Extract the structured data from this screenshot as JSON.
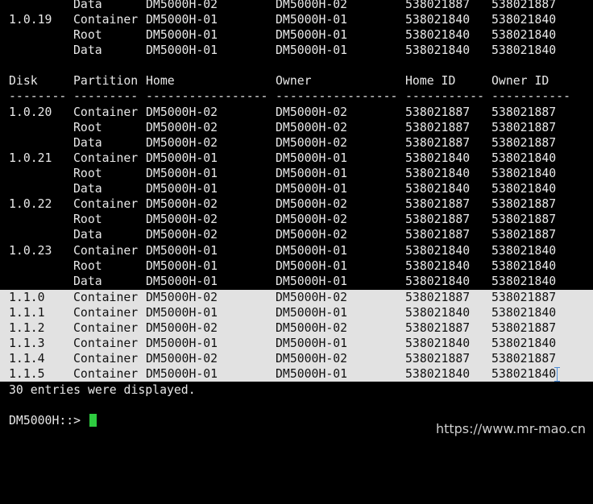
{
  "colors": {
    "background": "#000000",
    "text": "#e8e8e8",
    "selection": "#e2e2e2",
    "prompt_cursor": "#2ecc40"
  },
  "top_rows": [
    {
      "disk": "",
      "partition": "Data",
      "home": "DM5000H-02",
      "owner": "DM5000H-02",
      "home_id": "538021887",
      "owner_id": "538021887"
    },
    {
      "disk": "1.0.19",
      "partition": "Container",
      "home": "DM5000H-01",
      "owner": "DM5000H-01",
      "home_id": "538021840",
      "owner_id": "538021840"
    },
    {
      "disk": "",
      "partition": "Root",
      "home": "DM5000H-01",
      "owner": "DM5000H-01",
      "home_id": "538021840",
      "owner_id": "538021840"
    },
    {
      "disk": "",
      "partition": "Data",
      "home": "DM5000H-01",
      "owner": "DM5000H-01",
      "home_id": "538021840",
      "owner_id": "538021840"
    }
  ],
  "header": {
    "disk": "Disk",
    "partition": "Partition",
    "home": "Home",
    "owner": "Owner",
    "home_id": "Home ID",
    "owner_id": "Owner ID"
  },
  "separator": {
    "disk": "--------",
    "partition": "---------",
    "home": "-----------------",
    "owner": "-----------------",
    "home_id": "-----------",
    "owner_id": "-----------"
  },
  "rows": [
    {
      "disk": "1.0.20",
      "partition": "Container",
      "home": "DM5000H-02",
      "owner": "DM5000H-02",
      "home_id": "538021887",
      "owner_id": "538021887"
    },
    {
      "disk": "",
      "partition": "Root",
      "home": "DM5000H-02",
      "owner": "DM5000H-02",
      "home_id": "538021887",
      "owner_id": "538021887"
    },
    {
      "disk": "",
      "partition": "Data",
      "home": "DM5000H-02",
      "owner": "DM5000H-02",
      "home_id": "538021887",
      "owner_id": "538021887"
    },
    {
      "disk": "1.0.21",
      "partition": "Container",
      "home": "DM5000H-01",
      "owner": "DM5000H-01",
      "home_id": "538021840",
      "owner_id": "538021840"
    },
    {
      "disk": "",
      "partition": "Root",
      "home": "DM5000H-01",
      "owner": "DM5000H-01",
      "home_id": "538021840",
      "owner_id": "538021840"
    },
    {
      "disk": "",
      "partition": "Data",
      "home": "DM5000H-01",
      "owner": "DM5000H-01",
      "home_id": "538021840",
      "owner_id": "538021840"
    },
    {
      "disk": "1.0.22",
      "partition": "Container",
      "home": "DM5000H-02",
      "owner": "DM5000H-02",
      "home_id": "538021887",
      "owner_id": "538021887"
    },
    {
      "disk": "",
      "partition": "Root",
      "home": "DM5000H-02",
      "owner": "DM5000H-02",
      "home_id": "538021887",
      "owner_id": "538021887"
    },
    {
      "disk": "",
      "partition": "Data",
      "home": "DM5000H-02",
      "owner": "DM5000H-02",
      "home_id": "538021887",
      "owner_id": "538021887"
    },
    {
      "disk": "1.0.23",
      "partition": "Container",
      "home": "DM5000H-01",
      "owner": "DM5000H-01",
      "home_id": "538021840",
      "owner_id": "538021840"
    },
    {
      "disk": "",
      "partition": "Root",
      "home": "DM5000H-01",
      "owner": "DM5000H-01",
      "home_id": "538021840",
      "owner_id": "538021840"
    },
    {
      "disk": "",
      "partition": "Data",
      "home": "DM5000H-01",
      "owner": "DM5000H-01",
      "home_id": "538021840",
      "owner_id": "538021840"
    }
  ],
  "selected_rows": [
    {
      "disk": "1.1.0",
      "partition": "Container",
      "home": "DM5000H-02",
      "owner": "DM5000H-02",
      "home_id": "538021887",
      "owner_id": "538021887"
    },
    {
      "disk": "1.1.1",
      "partition": "Container",
      "home": "DM5000H-01",
      "owner": "DM5000H-01",
      "home_id": "538021840",
      "owner_id": "538021840"
    },
    {
      "disk": "1.1.2",
      "partition": "Container",
      "home": "DM5000H-02",
      "owner": "DM5000H-02",
      "home_id": "538021887",
      "owner_id": "538021887"
    },
    {
      "disk": "1.1.3",
      "partition": "Container",
      "home": "DM5000H-01",
      "owner": "DM5000H-01",
      "home_id": "538021840",
      "owner_id": "538021840"
    },
    {
      "disk": "1.1.4",
      "partition": "Container",
      "home": "DM5000H-02",
      "owner": "DM5000H-02",
      "home_id": "538021887",
      "owner_id": "538021887"
    },
    {
      "disk": "1.1.5",
      "partition": "Container",
      "home": "DM5000H-01",
      "owner": "DM5000H-01",
      "home_id": "538021840",
      "owner_id": "538021840"
    }
  ],
  "summary": "30 entries were displayed.",
  "prompt": "DM5000H::>",
  "watermark": "https://www.mr-mao.cn"
}
